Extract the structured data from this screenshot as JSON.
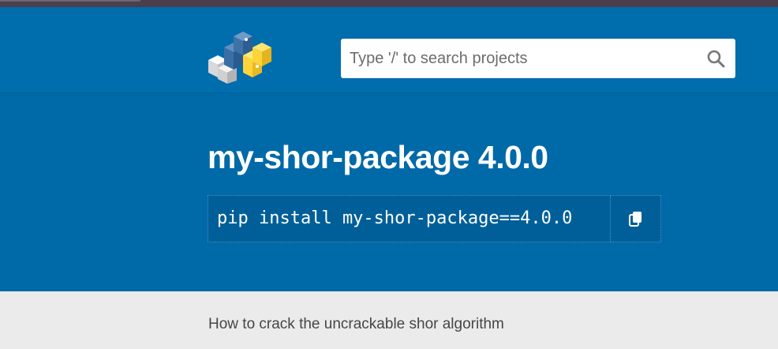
{
  "header": {
    "logo_icon": "pypi-cubes-logo",
    "search": {
      "placeholder": "Type '/' to search projects",
      "value": "",
      "button_icon": "search-icon"
    }
  },
  "package": {
    "title": "my-shor-package 4.0.0",
    "pip_command": "pip install my-shor-package==4.0.0",
    "copy_icon": "copy-icon",
    "summary": "How to crack the uncrackable shor algorithm"
  },
  "colors": {
    "header_bg": "#006dad",
    "hero_bg": "#0069a8",
    "page_bg": "#ebebeb",
    "top_strip": "#4a3f4a"
  }
}
